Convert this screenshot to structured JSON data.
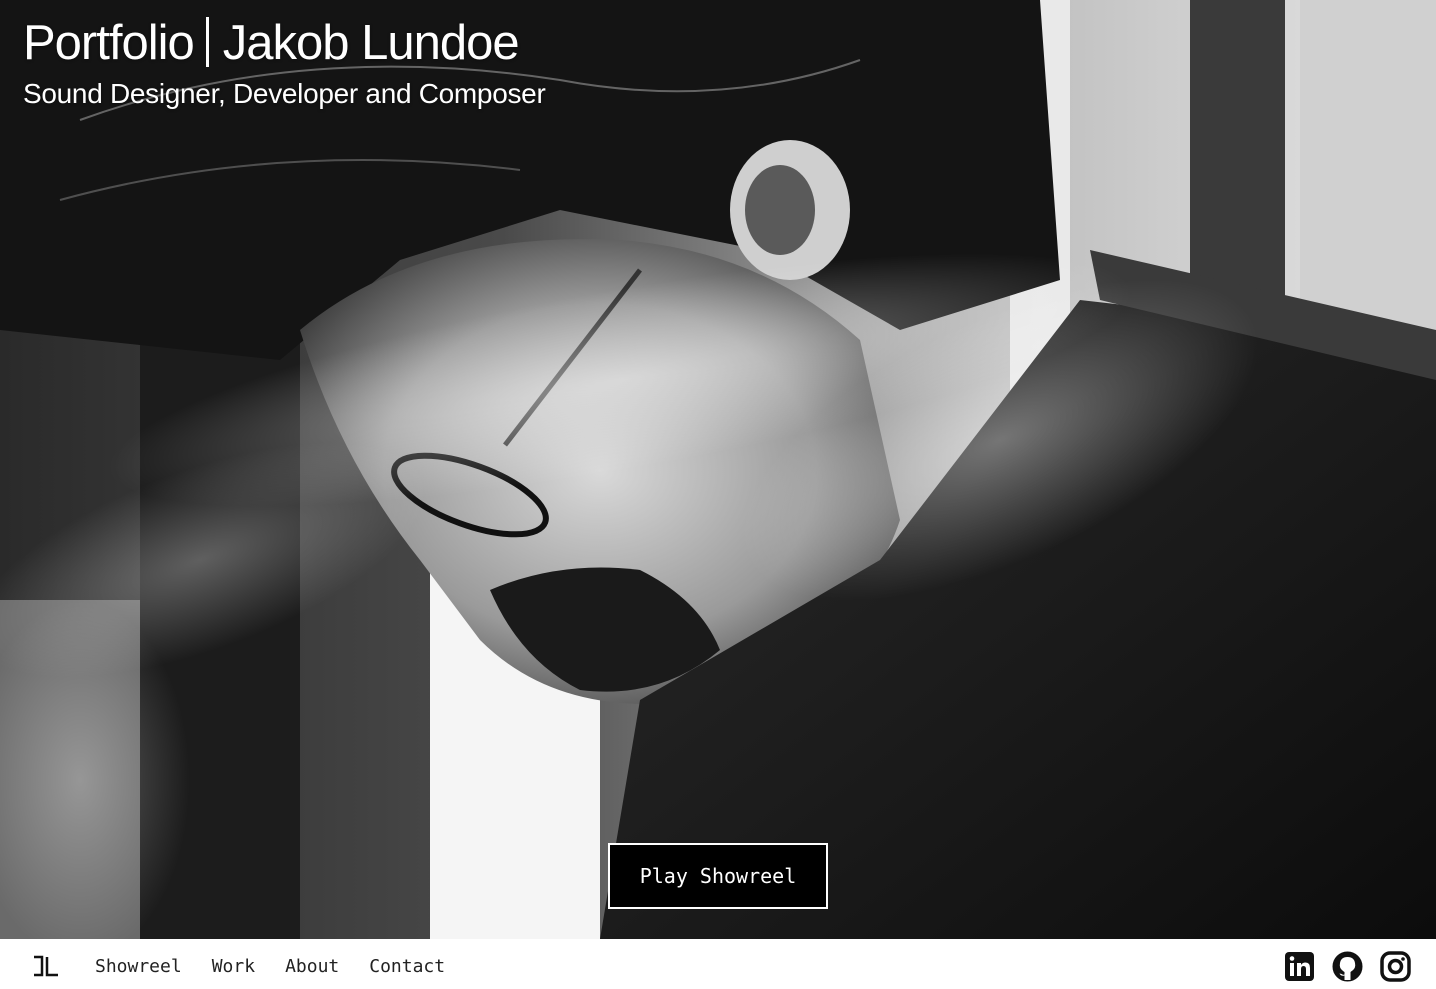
{
  "hero": {
    "title_left": "Portfolio",
    "title_right": "Jakob Lundoe",
    "subtitle": "Sound Designer, Developer and Composer",
    "play_label": "Play Showreel"
  },
  "nav": {
    "items": [
      {
        "label": "Showreel"
      },
      {
        "label": "Work"
      },
      {
        "label": "About"
      },
      {
        "label": "Contact"
      }
    ],
    "social": [
      {
        "icon": "linkedin-icon"
      },
      {
        "icon": "github-icon"
      },
      {
        "icon": "instagram-icon"
      }
    ]
  },
  "colors": {
    "accent": "#000000",
    "text_light": "#ffffff",
    "nav_text": "#222222"
  }
}
